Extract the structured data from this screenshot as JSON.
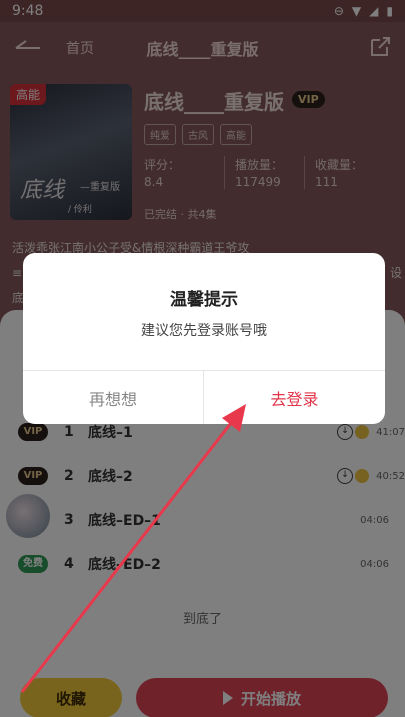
{
  "status_bar": {
    "time": "9:48",
    "icons": [
      "do-not-disturb-icon",
      "wifi-icon",
      "signal-icon",
      "battery-icon"
    ]
  },
  "nav": {
    "home": "首页",
    "title": "底线____重复版"
  },
  "book": {
    "cover_tag": "高能",
    "cover_title": "底线",
    "cover_sub": "—重复版",
    "cover_author": "/ 伶利",
    "title": "底线____重复版",
    "vip": "VIP",
    "tags": [
      "纯爱",
      "古风",
      "高能"
    ],
    "stats": [
      {
        "label": "评分：",
        "value": "8.4"
      },
      {
        "label": "播放量：",
        "value": "117499"
      },
      {
        "label": "收藏量：",
        "value": "111"
      }
    ],
    "status": "已完结 · 共4集",
    "desc_line1": "活泼乖张江南小公子受&情根深种霸道王爷攻",
    "desc_line2": "≡",
    "desc_line2_end": "设",
    "desc_line3": "底"
  },
  "episodes": [
    {
      "badge": "VIP",
      "num": "1",
      "name": "底线–1",
      "time": "41:07"
    },
    {
      "badge": "VIP",
      "num": "2",
      "name": "底线–2",
      "time": "40:52"
    },
    {
      "badge": "",
      "num": "3",
      "name": "底线–ED–1",
      "time": "04:06"
    },
    {
      "badge": "免费",
      "num": "4",
      "name": "底线–ED–2",
      "time": "04:06"
    }
  ],
  "end_label": "到底了",
  "buttons": {
    "favorite": "收藏",
    "play": "开始播放"
  },
  "dialog": {
    "title": "温馨提示",
    "message": "建议您先登录账号哦",
    "cancel": "再想想",
    "confirm": "去登录"
  },
  "colors": {
    "accent": "#e14556",
    "vip_gold": "#e7c98a",
    "header_bg": "#84585a",
    "arrow": "#e8394c"
  }
}
